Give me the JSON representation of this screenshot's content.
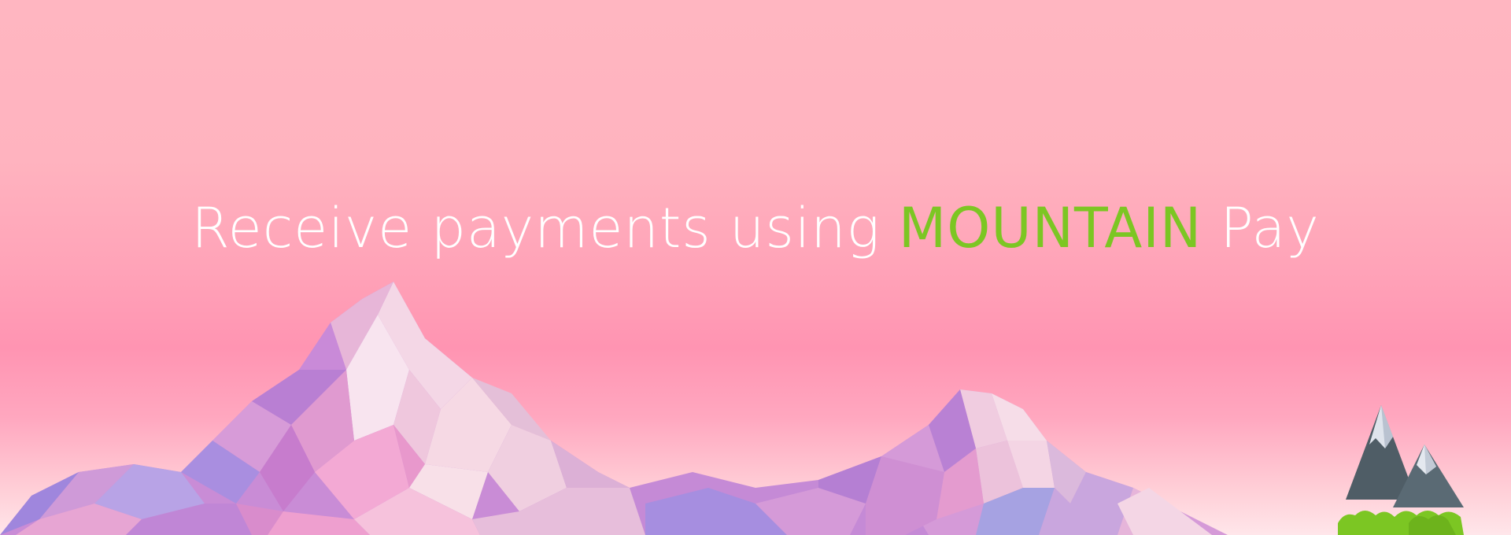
{
  "headline": {
    "prefix": "Receive payments using ",
    "brand": "MOUNTAIN",
    "suffix": " Pay"
  },
  "colors": {
    "brand_green": "#7cc623",
    "headline_text": "#ffffff",
    "sky_top": "#ffb6c1",
    "sky_mid": "#ff94b2"
  },
  "illustration": {
    "mountains": "low-poly-mountain-range",
    "logo": "mountain-logo-icon"
  }
}
